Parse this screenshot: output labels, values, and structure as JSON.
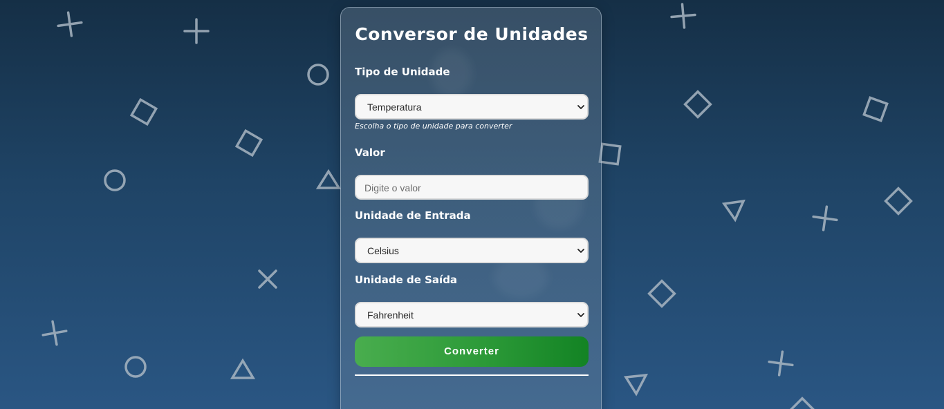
{
  "app": {
    "title": "Conversor de Unidades"
  },
  "form": {
    "unit_type": {
      "label": "Tipo de Unidade",
      "selected": "Temperatura",
      "hint": "Escolha o tipo de unidade para converter"
    },
    "value": {
      "label": "Valor",
      "placeholder": "Digite o valor",
      "current": ""
    },
    "input_unit": {
      "label": "Unidade de Entrada",
      "selected": "Celsius"
    },
    "output_unit": {
      "label": "Unidade de Saída",
      "selected": "Fahrenheit"
    },
    "convert_label": "Converter"
  },
  "icons": {
    "background_shapes": [
      "cross-icon",
      "circle-icon",
      "square-icon",
      "triangle-icon"
    ],
    "select_arrow": "chevron-down-icon"
  },
  "colors": {
    "background_top": "#152f46",
    "background_bottom": "#2a5683",
    "button_start": "#49ad4e",
    "button_end": "#138324",
    "shape_stroke": "#a9b6c2"
  }
}
